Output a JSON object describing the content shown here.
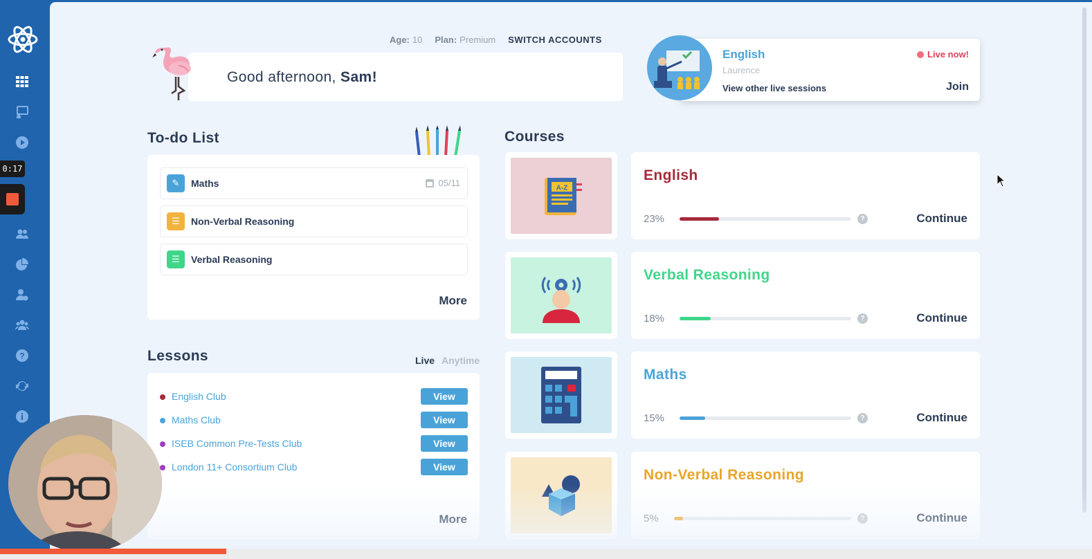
{
  "recording": {
    "timer": "0:17"
  },
  "sidebar": {
    "items": [
      "apps-grid",
      "classroom",
      "video",
      "users",
      "pie-chart",
      "user-settings",
      "group",
      "help",
      "refresh",
      "info"
    ]
  },
  "account": {
    "age_label": "Age:",
    "age_value": "10",
    "plan_label": "Plan:",
    "plan_value": "Premium",
    "switch_label": "SWITCH ACCOUNTS"
  },
  "greeting": {
    "prefix": "Good afternoon,",
    "name": "Sam!"
  },
  "live_session": {
    "subject": "English",
    "teacher": "Laurence",
    "status": "Live now!",
    "other_link": "View other live sessions",
    "join_label": "Join"
  },
  "todo": {
    "title": "To-do List",
    "items": [
      {
        "label": "Maths",
        "date": "05/11",
        "badge_color": "#4aa3d8",
        "icon": "pencil-icon"
      },
      {
        "label": "Non-Verbal Reasoning",
        "date": "",
        "badge_color": "#f2b33d",
        "icon": "checklist-icon"
      },
      {
        "label": "Verbal Reasoning",
        "date": "",
        "badge_color": "#3fd68a",
        "icon": "checklist-icon"
      }
    ],
    "more_label": "More"
  },
  "lessons": {
    "title": "Lessons",
    "tab_live": "Live",
    "tab_anytime": "Anytime",
    "items": [
      {
        "name": "English Club",
        "dot_color": "#a52a3a",
        "button": "View"
      },
      {
        "name": "Maths Club",
        "dot_color": "#4aa3d8",
        "button": "View"
      },
      {
        "name": "ISEB Common Pre-Tests Club",
        "dot_color": "#9b3fc0",
        "button": "View"
      },
      {
        "name": "London 11+ Consortium Club",
        "dot_color": "#9b3fc0",
        "button": "View"
      }
    ],
    "more_label": "More"
  },
  "courses": {
    "title": "Courses",
    "items": [
      {
        "name": "English",
        "percent": "23%",
        "progress": 0.23,
        "color": "#a52a3a",
        "thumb_bg": "#ecd0d6",
        "continue": "Continue"
      },
      {
        "name": "Verbal Reasoning",
        "percent": "18%",
        "progress": 0.18,
        "color": "#3fd68a",
        "thumb_bg": "#c8f3e0",
        "continue": "Continue"
      },
      {
        "name": "Maths",
        "percent": "15%",
        "progress": 0.15,
        "color": "#4aa3d8",
        "thumb_bg": "#d0eaf3",
        "continue": "Continue"
      },
      {
        "name": "Non-Verbal Reasoning",
        "percent": "5%",
        "progress": 0.05,
        "color": "#e8a52a",
        "thumb_bg": "#f8e8c8",
        "continue": "Continue"
      }
    ]
  },
  "video": {
    "played_fraction": 0.207
  }
}
